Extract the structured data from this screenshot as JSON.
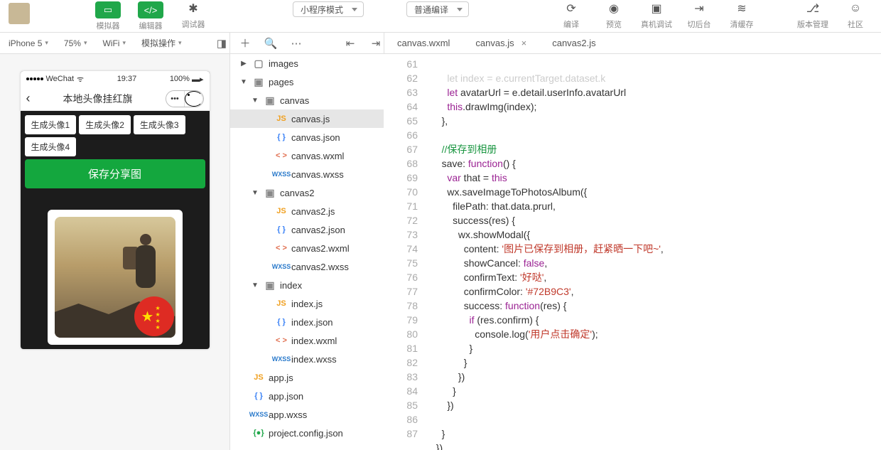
{
  "toolbar": {
    "mode_select": "小程序模式",
    "compile_select": "普通编译",
    "buttons": {
      "simulator": "模拟器",
      "editor": "编辑器",
      "debugger": "调试器",
      "compile": "编译",
      "preview": "预览",
      "remote_debug": "真机调试",
      "background": "切后台",
      "clear_cache": "清缓存",
      "version": "版本管理",
      "community": "社区"
    }
  },
  "subheader": {
    "device": "iPhone 5",
    "zoom": "75%",
    "network": "WiFi",
    "simulate": "模拟操作"
  },
  "tabs": {
    "t1": "canvas.wxml",
    "t2": "canvas.js",
    "t3": "canvas2.js"
  },
  "phone": {
    "carrier": "WeChat",
    "time": "19:37",
    "battery": "100%",
    "title": "本地头像挂红旗",
    "gen1": "生成头像1",
    "gen2": "生成头像2",
    "gen3": "生成头像3",
    "gen4": "生成头像4",
    "save": "保存分享图"
  },
  "tree": {
    "images": "images",
    "pages": "pages",
    "canvas": "canvas",
    "canvas_js": "canvas.js",
    "canvas_json": "canvas.json",
    "canvas_wxml": "canvas.wxml",
    "canvas_wxss": "canvas.wxss",
    "canvas2": "canvas2",
    "canvas2_js": "canvas2.js",
    "canvas2_json": "canvas2.json",
    "canvas2_wxml": "canvas2.wxml",
    "canvas2_wxss": "canvas2.wxss",
    "index": "index",
    "index_js": "index.js",
    "index_json": "index.json",
    "index_wxml": "index.wxml",
    "index_wxss": "index.wxss",
    "app_js": "app.js",
    "app_json": "app.json",
    "app_wxss": "app.wxss",
    "project_config": "project.config.json"
  },
  "code": {
    "lines": [
      "61",
      "62",
      "63",
      "64",
      "65",
      "66",
      "67",
      "68",
      "69",
      "70",
      "71",
      "72",
      "73",
      "74",
      "75",
      "76",
      "77",
      "78",
      "79",
      "80",
      "81",
      "82",
      "83",
      "84",
      "85",
      "86",
      "87"
    ],
    "l61": "let index = e.currentTarget.dataset.k",
    "l62_a": "let",
    "l62_b": " avatarUrl = e.detail.userInfo.avatarUrl",
    "l63_a": "this",
    "l63_b": ".drawImg(index);",
    "l64": "},",
    "l66": "//保存到相册",
    "l67_a": "save: ",
    "l67_b": "function",
    "l67_c": "() {",
    "l68_a": "var",
    "l68_b": " that = ",
    "l68_c": "this",
    "l69": "wx.saveImageToPhotosAlbum({",
    "l70": "filePath: that.data.prurl,",
    "l71": "success(res) {",
    "l72": "wx.showModal({",
    "l73_a": "content: ",
    "l73_b": "'图片已保存到相册，赶紧晒一下吧~'",
    "l73_c": ",",
    "l74_a": "showCancel: ",
    "l74_b": "false",
    "l74_c": ",",
    "l75_a": "confirmText: ",
    "l75_b": "'好哒'",
    "l75_c": ",",
    "l76_a": "confirmColor: ",
    "l76_b": "'#72B9C3'",
    "l76_c": ",",
    "l77_a": "success: ",
    "l77_b": "function",
    "l77_c": "(res) {",
    "l78_a": "if",
    "l78_b": " (res.confirm) {",
    "l79_a": "console.log(",
    "l79_b": "'用户点击确定'",
    "l79_c": ");",
    "l80": "}",
    "l81": "}",
    "l82": "})",
    "l83": "}",
    "l84": "})",
    "l86": "}",
    "l87": "})"
  }
}
